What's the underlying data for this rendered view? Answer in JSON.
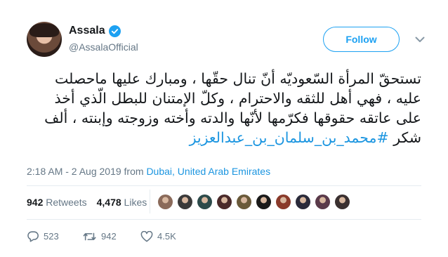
{
  "user": {
    "display_name": "Assala",
    "handle": "@AssalaOfficial",
    "verified_icon": "verified-badge-icon"
  },
  "follow_label": "Follow",
  "tweet": {
    "text": "تستحقّ المرأة السّعوديّه أنّ تنال حقّها ، ومبارك عليها ماحصلت عليه ، فهي أهل للثقه والاحترام ، وكلّ الإمتنان للبطل الّذي أخذ على عاتقه حقوقها فكرّمها لأنّها والدته وأخته وزوجته وإبنته ، ألف شكر",
    "hashtag": "#محمد_بن_سلمان_بن_عبدالعزيز"
  },
  "meta": {
    "time_date": "2:18 AM - 2 Aug 2019 from ",
    "location": "Dubai, United Arab Emirates"
  },
  "stats": {
    "retweets_count": "942",
    "retweets_label": "Retweets",
    "likes_count": "4,478",
    "likes_label": "Likes"
  },
  "liker_avatars": [
    "#8a6a5a",
    "#3a3a3a",
    "#2c4a4a",
    "#4a2a2a",
    "#6a5a3a",
    "#1a1a1a",
    "#8a3a2a",
    "#2a2a3a",
    "#5a3a4a",
    "#3a3030"
  ],
  "actions": {
    "replies": "523",
    "retweets": "942",
    "likes": "4.5K"
  },
  "colors": {
    "accent": "#1da1f2",
    "link": "#1b95e0",
    "muted": "#657786",
    "text": "#14171a"
  }
}
